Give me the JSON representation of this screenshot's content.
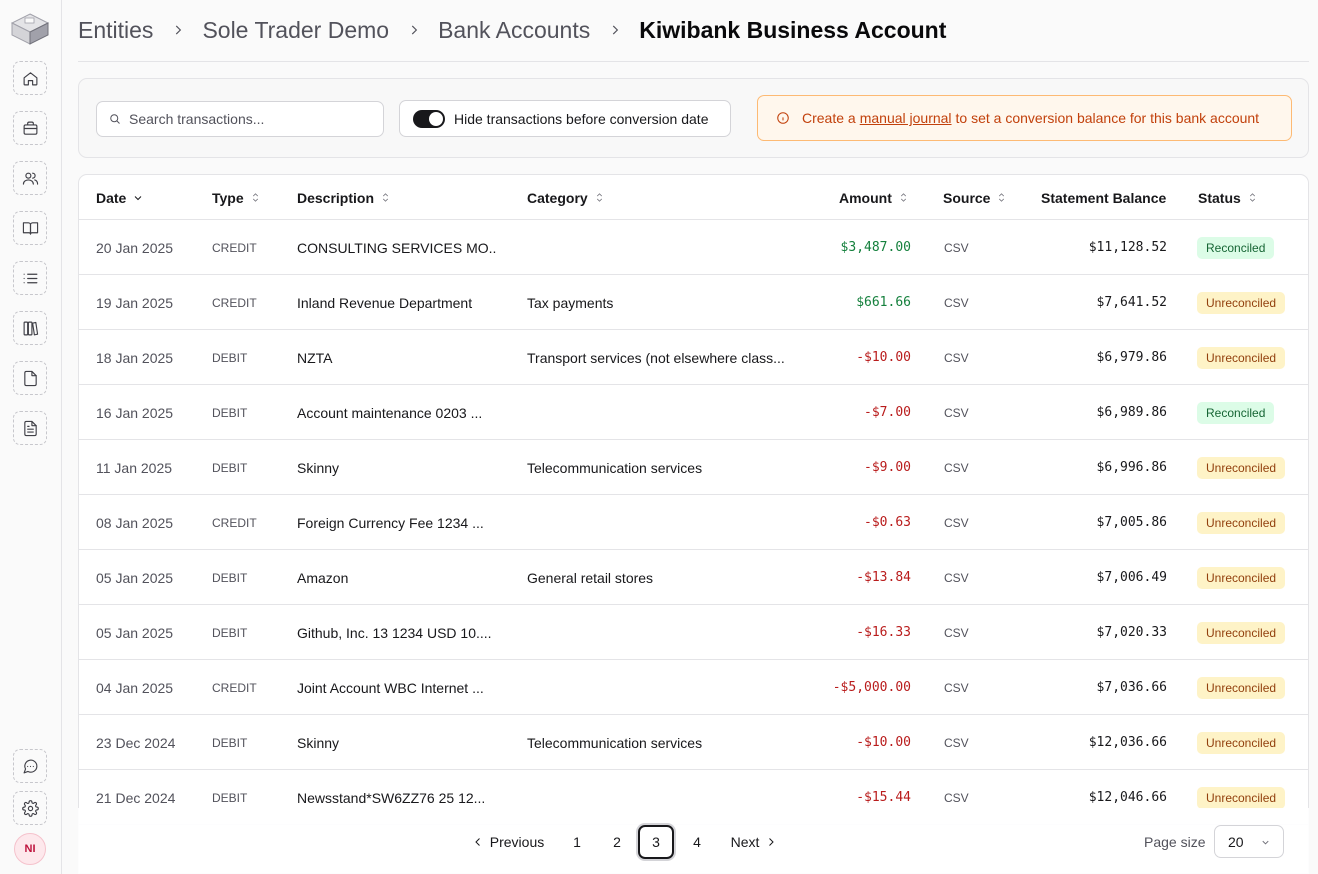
{
  "breadcrumb": {
    "items": [
      "Entities",
      "Sole Trader Demo",
      "Bank Accounts"
    ],
    "current": "Kiwibank Business Account"
  },
  "search": {
    "placeholder": "Search transactions..."
  },
  "toggle": {
    "label": "Hide transactions before conversion date",
    "on": true
  },
  "alert": {
    "prefix": "Create a",
    "link": "manual journal",
    "suffix": "to set a conversion balance for this bank account"
  },
  "table": {
    "columns": [
      "Date",
      "Type",
      "Description",
      "Category",
      "Amount",
      "Source",
      "Statement Balance",
      "Status"
    ],
    "rows": [
      {
        "date": "20 Jan 2025",
        "type": "CREDIT",
        "description": "CONSULTING SERVICES MO...",
        "category": "",
        "amount": "$3,487.00",
        "source": "CSV",
        "balance": "$11,128.52",
        "status": "Reconciled"
      },
      {
        "date": "19 Jan 2025",
        "type": "CREDIT",
        "description": "Inland Revenue Department",
        "category": "Tax payments",
        "amount": "$661.66",
        "source": "CSV",
        "balance": "$7,641.52",
        "status": "Unreconciled"
      },
      {
        "date": "18 Jan 2025",
        "type": "DEBIT",
        "description": "NZTA",
        "category": "Transport services (not elsewhere class...",
        "amount": "-$10.00",
        "source": "CSV",
        "balance": "$6,979.86",
        "status": "Unreconciled"
      },
      {
        "date": "16 Jan 2025",
        "type": "DEBIT",
        "description": "Account maintenance 0203 ...",
        "category": "",
        "amount": "-$7.00",
        "source": "CSV",
        "balance": "$6,989.86",
        "status": "Reconciled"
      },
      {
        "date": "11 Jan 2025",
        "type": "DEBIT",
        "description": "Skinny",
        "category": "Telecommunication services",
        "amount": "-$9.00",
        "source": "CSV",
        "balance": "$6,996.86",
        "status": "Unreconciled"
      },
      {
        "date": "08 Jan 2025",
        "type": "CREDIT",
        "description": "Foreign Currency Fee 1234 ...",
        "category": "",
        "amount": "-$0.63",
        "source": "CSV",
        "balance": "$7,005.86",
        "status": "Unreconciled"
      },
      {
        "date": "05 Jan 2025",
        "type": "DEBIT",
        "description": "Amazon",
        "category": "General retail stores",
        "amount": "-$13.84",
        "source": "CSV",
        "balance": "$7,006.49",
        "status": "Unreconciled"
      },
      {
        "date": "05 Jan 2025",
        "type": "DEBIT",
        "description": "Github, Inc. 13 1234 USD 10....",
        "category": "",
        "amount": "-$16.33",
        "source": "CSV",
        "balance": "$7,020.33",
        "status": "Unreconciled"
      },
      {
        "date": "04 Jan 2025",
        "type": "CREDIT",
        "description": "Joint Account WBC Internet ...",
        "category": "",
        "amount": "-$5,000.00",
        "source": "CSV",
        "balance": "$7,036.66",
        "status": "Unreconciled"
      },
      {
        "date": "23 Dec 2024",
        "type": "DEBIT",
        "description": "Skinny",
        "category": "Telecommunication services",
        "amount": "-$10.00",
        "source": "CSV",
        "balance": "$12,036.66",
        "status": "Unreconciled"
      },
      {
        "date": "21 Dec 2024",
        "type": "DEBIT",
        "description": "Newsstand*SW6ZZ76 25 12...",
        "category": "",
        "amount": "-$15.44",
        "source": "CSV",
        "balance": "$12,046.66",
        "status": "Unreconciled"
      }
    ]
  },
  "pagination": {
    "previous": "Previous",
    "next": "Next",
    "pages": [
      "1",
      "2",
      "3",
      "4"
    ],
    "current": "3",
    "page_size_label": "Page size",
    "page_size": "20"
  },
  "user": {
    "initials": "NI"
  },
  "colors": {
    "positive": "#15803d",
    "negative": "#b91c1c",
    "alert": "#c2410c",
    "reconciled_bg": "#dcfce7",
    "unreconciled_bg": "#fef3c7"
  }
}
